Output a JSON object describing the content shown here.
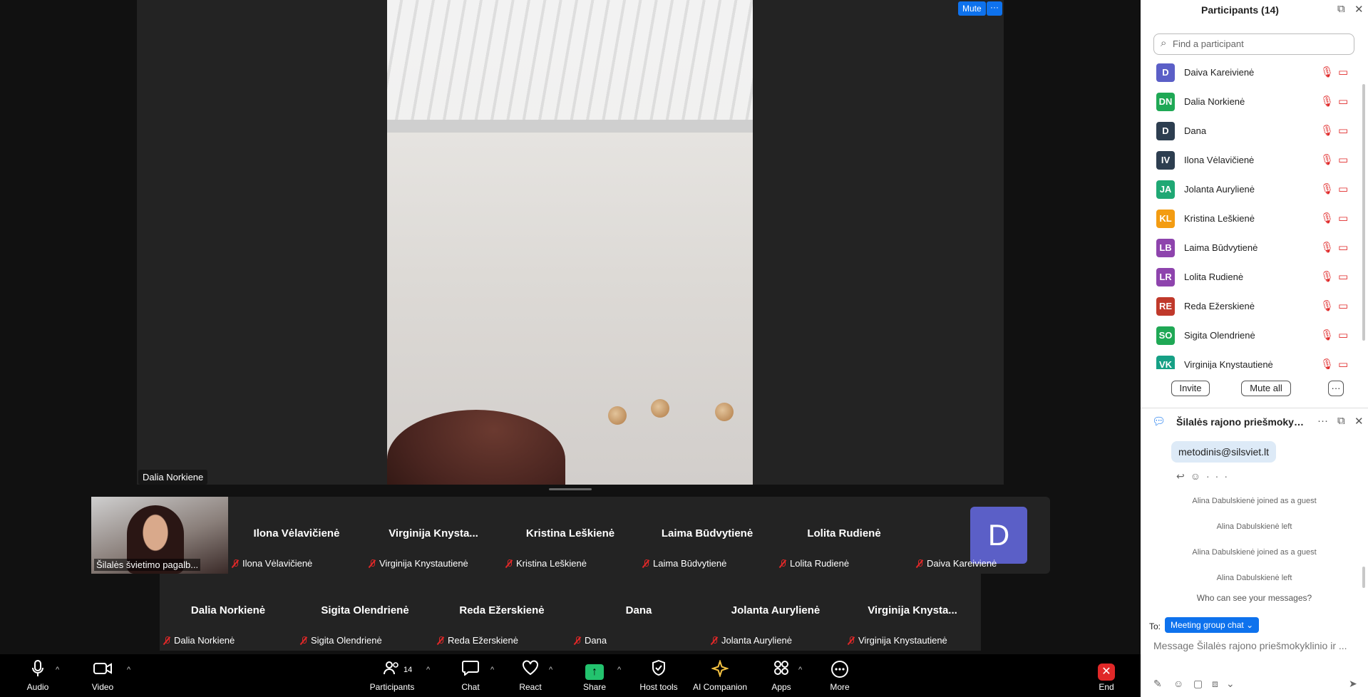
{
  "main_video": {
    "name_tag": "Dalia Norkiene",
    "mute_label": "Mute",
    "more_label": "···"
  },
  "gallery": {
    "self_label": "Šilalės švietimo pagalb...",
    "row1": [
      {
        "big": "Ilona Vėlavičienė",
        "small": "Ilona Vėlavičienė"
      },
      {
        "big": "Virginija  Knysta...",
        "small": "Virginija Knystautienė"
      },
      {
        "big": "Kristina Leškienė",
        "small": "Kristina Leškienė"
      },
      {
        "big": "Laima Būdvytienė",
        "small": "Laima Būdvytienė"
      },
      {
        "big": "Lolita Rudienė",
        "small": "Lolita Rudienė"
      }
    ],
    "avatar_tile": {
      "letter": "D",
      "small": "Daiva Kareivienė"
    },
    "row2": [
      {
        "big": "Dalia Norkienė",
        "small": "Dalia Norkienė"
      },
      {
        "big": "Sigita Olendrienė",
        "small": "Sigita Olendrienė"
      },
      {
        "big": "Reda Ežerskienė",
        "small": "Reda Ežerskienė"
      },
      {
        "big": "Dana",
        "small": "Dana"
      },
      {
        "big": "Jolanta Aurylienė",
        "small": "Jolanta Aurylienė"
      },
      {
        "big": "Virginija  Knysta...",
        "small": "Virginija Knystautienė"
      }
    ]
  },
  "toolbar": {
    "audio": "Audio",
    "video": "Video",
    "participants": "Participants",
    "participants_count": "14",
    "chat": "Chat",
    "react": "React",
    "share": "Share",
    "host_tools": "Host tools",
    "ai_companion": "AI Companion",
    "apps": "Apps",
    "more": "More",
    "end": "End"
  },
  "participants_panel": {
    "title": "Participants (14)",
    "search_placeholder": "Find a participant",
    "items": [
      {
        "initials": "D",
        "name": "Daiva Kareivienė",
        "color": "#5b5fc7"
      },
      {
        "initials": "DN",
        "name": "Dalia Norkienė",
        "color": "#1fa855"
      },
      {
        "initials": "D",
        "name": "Dana",
        "color": "#2d3e50"
      },
      {
        "initials": "IV",
        "name": "Ilona Vėlavičienė",
        "color": "#2d3e50"
      },
      {
        "initials": "JA",
        "name": "Jolanta Aurylienė",
        "color": "#1fa874"
      },
      {
        "initials": "KL",
        "name": "Kristina Leškienė",
        "color": "#f39c12"
      },
      {
        "initials": "LB",
        "name": "Laima Būdvytienė",
        "color": "#8e44ad"
      },
      {
        "initials": "LR",
        "name": "Lolita Rudienė",
        "color": "#8e44ad"
      },
      {
        "initials": "RE",
        "name": "Reda Ežerskienė",
        "color": "#c0392b"
      },
      {
        "initials": "SO",
        "name": "Sigita Olendrienė",
        "color": "#1fa855"
      },
      {
        "initials": "VK",
        "name": "Virginija Knystautienė",
        "color": "#16a085"
      }
    ],
    "invite": "Invite",
    "mute_all": "Mute all",
    "more": "···"
  },
  "chat_panel": {
    "title": "Šilalės rajono priešmokyklin...",
    "bubble": "metodinis@silsviet.lt",
    "system_messages": [
      "Alina Dabulskienė joined as a guest",
      "Alina Dabulskienė left",
      "Alina Dabulskienė joined as a guest",
      "Alina Dabulskienė left"
    ],
    "who_can_see": "Who can see your messages?",
    "to_label": "To:",
    "to_value": "Meeting group chat",
    "input_placeholder": "Message Šilalės rajono priešmokyklinio ir ..."
  }
}
